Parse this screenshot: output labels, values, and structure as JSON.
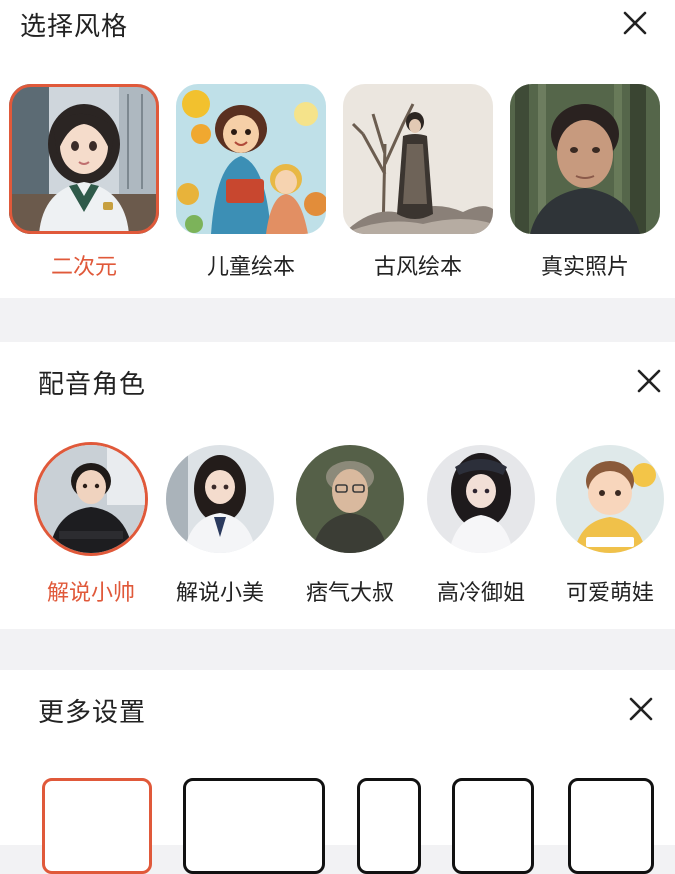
{
  "style_section": {
    "title": "选择风格",
    "options": [
      {
        "label": "二次元",
        "selected": true
      },
      {
        "label": "儿童绘本",
        "selected": false
      },
      {
        "label": "古风绘本",
        "selected": false
      },
      {
        "label": "真实照片",
        "selected": false
      }
    ]
  },
  "voice_section": {
    "title": "配音角色",
    "options": [
      {
        "label": "解说小帅",
        "selected": true
      },
      {
        "label": "解说小美",
        "selected": false
      },
      {
        "label": "痞气大叔",
        "selected": false
      },
      {
        "label": "高冷御姐",
        "selected": false
      },
      {
        "label": "可爱萌娃",
        "selected": false
      }
    ]
  },
  "settings_section": {
    "title": "更多设置"
  },
  "colors": {
    "accent": "#e0593a",
    "background": "#f2f2f4",
    "panel": "#ffffff",
    "text": "#222222"
  },
  "icons": {
    "close": "close-icon"
  }
}
